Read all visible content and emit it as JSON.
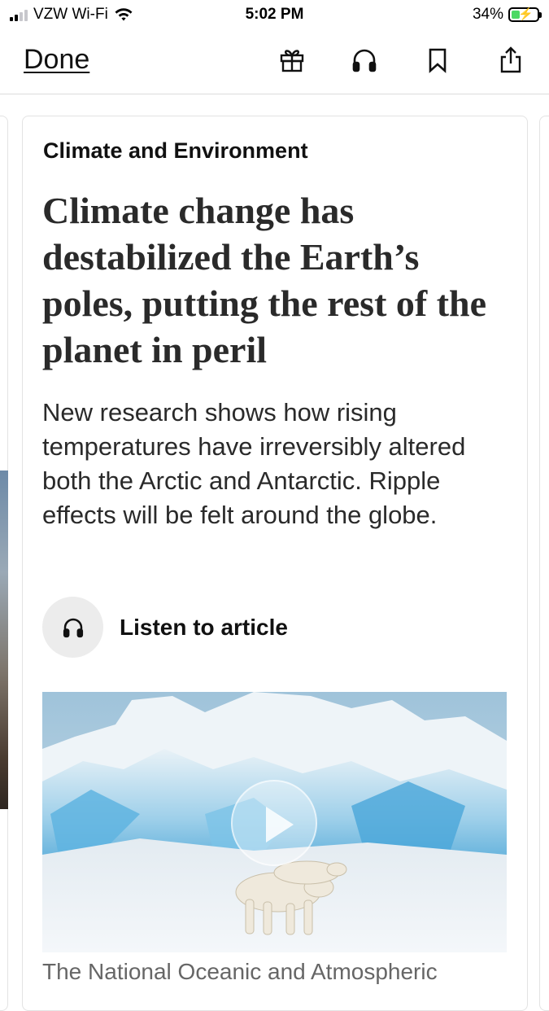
{
  "status_bar": {
    "carrier": "VZW Wi-Fi",
    "time": "5:02 PM",
    "battery_percent": "34%",
    "battery_level": 0.34,
    "charging": true,
    "signal_bars": 2
  },
  "nav": {
    "done_label": "Done",
    "icons": [
      "gift-icon",
      "headphones-icon",
      "bookmark-icon",
      "share-icon"
    ]
  },
  "article": {
    "kicker": "Climate and Environment",
    "headline": "Climate change has destabilized the Earth’s poles, putting the rest of the planet in peril",
    "dek": "New research shows how rising temperatures have irreversibly altered both the Arctic and Antarctic. Ripple effects will be felt around the globe.",
    "listen_label": "Listen to article",
    "media": {
      "type": "video",
      "description_icon": "play-icon"
    },
    "caption": "The National Oceanic and Atmospheric"
  },
  "colors": {
    "accent_text": "#111111",
    "headline_text": "#2a2a2a",
    "listen_button_bg": "#ececec",
    "battery_fill": "#4cd964"
  }
}
